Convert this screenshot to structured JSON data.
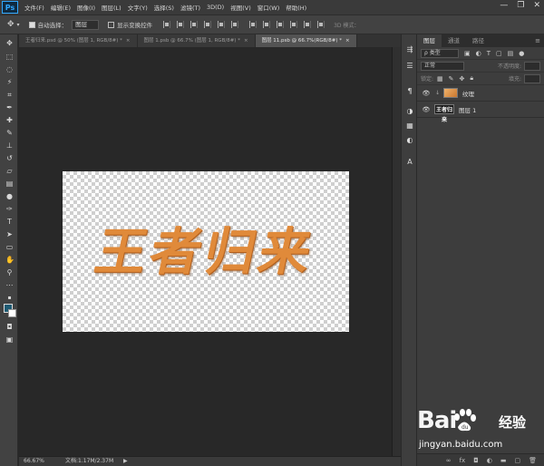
{
  "app": {
    "logo": "Ps"
  },
  "menu": [
    "文件(F)",
    "编辑(E)",
    "图像(I)",
    "图层(L)",
    "文字(Y)",
    "选择(S)",
    "滤镜(T)",
    "3D(D)",
    "视图(V)",
    "窗口(W)",
    "帮助(H)"
  ],
  "window_controls": {
    "minimize": "—",
    "restore": "❐",
    "close": "✕"
  },
  "options": {
    "auto_select_label": "自动选择：",
    "auto_select_checked": true,
    "auto_select_target": "图层",
    "show_transform_label": "显示变换控件",
    "show_transform_checked": false,
    "mode_3d_label": "3D 模式："
  },
  "tabs": [
    {
      "label": "王者归来.psd @ 50% (图层 1, RGB/8#) *",
      "active": false
    },
    {
      "label": "图层 1.psb @ 66.7% (图层 1, RGB/8#) *",
      "active": false
    },
    {
      "label": "图层 11.psb @ 66.7%(RGB/8#) *",
      "active": true
    }
  ],
  "canvas": {
    "text": "王者归来"
  },
  "status": {
    "zoom": "66.67%",
    "doc_info": "文档:1.17M/2.37M",
    "arrow": "▶"
  },
  "colors": {
    "foreground": "#1f5b73",
    "background": "#ffffff",
    "text_fill": "#e08a3a"
  },
  "panel": {
    "tabs": [
      {
        "label": "图层",
        "active": true
      },
      {
        "label": "通道",
        "active": false
      },
      {
        "label": "路径",
        "active": false
      }
    ],
    "menu_icon": "≡",
    "filter_kind": "ρ 类型",
    "blend_mode": "正常",
    "opacity_label": "不透明度:",
    "lock_label": "锁定:",
    "fill_label": "填充:",
    "layers": [
      {
        "name": "纹理",
        "thumb": "texture",
        "visible": true,
        "clipped": true
      },
      {
        "name": "图层 1",
        "thumb": "王者归来",
        "visible": true,
        "clipped": false
      }
    ]
  },
  "watermark": {
    "brand": "Bai",
    "brand_suffix": "du",
    "cn": "经验",
    "url": "jingyan.baidu.com"
  }
}
